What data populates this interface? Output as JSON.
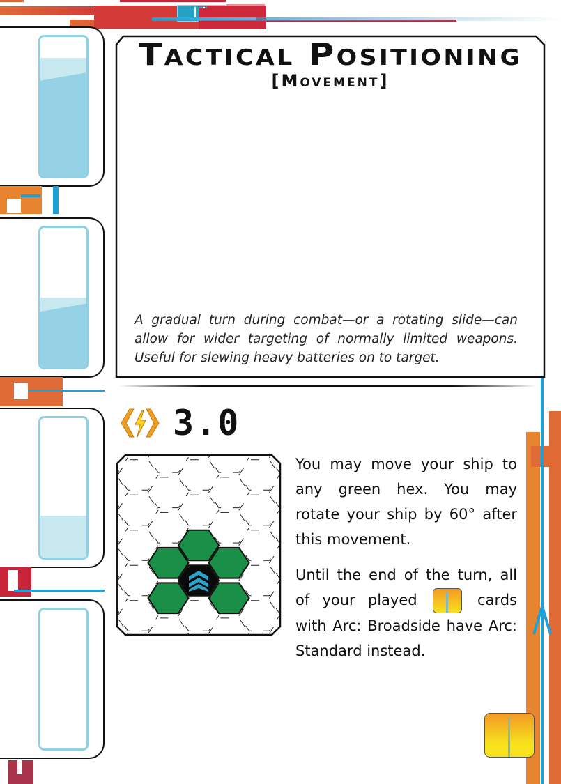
{
  "card": {
    "title": "Tactical Positioning",
    "subtitle": "[Movement]",
    "flavor_text": "A gradual turn during combat—or a rotating slide—can allow for wider targeting of normally limited weapons. Useful for slewing heavy batteries on to target.",
    "cost": "3.0",
    "cost_icon": "energy-bolt-icon",
    "rules": {
      "paragraph1": "You may move your ship to any green hex. You may rotate your ship by 60° after this movement.",
      "paragraph2_before": "Until the end of the turn, all of your played",
      "paragraph2_icon": "weapon-card-icon",
      "paragraph2_after": "cards with Arc: Broadside have Arc: Standard instead."
    },
    "card_type_icon": "weapon-card-icon"
  },
  "side_slots": [
    {
      "fill_percent": 85
    },
    {
      "fill_percent": 50
    },
    {
      "fill_percent": 30
    },
    {
      "fill_percent": 0
    }
  ],
  "hex_map": {
    "green_hexes": 5,
    "ship_icon": "chevron-ship-icon",
    "colors": {
      "green": "#1a8f47",
      "ship_hex": "#0a0a0a",
      "ship": "#2aa3cc"
    }
  },
  "colors": {
    "accent_red": "#c9253a",
    "accent_orange": "#e0783a",
    "accent_blue": "#1ea0d8",
    "slot_blue": "#8fd0e6"
  }
}
